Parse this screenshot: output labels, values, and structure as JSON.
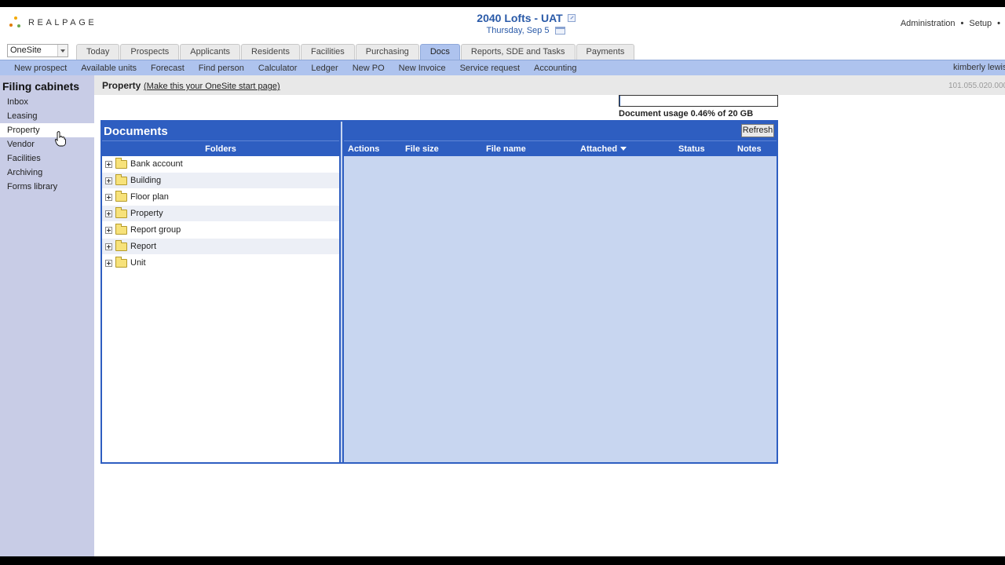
{
  "header": {
    "logo_text": "REALPAGE",
    "property_name": "2040 Lofts - UAT",
    "date": "Thursday, Sep 5",
    "top_links": [
      "Administration",
      "Setup"
    ]
  },
  "product_select": {
    "value": "OneSite"
  },
  "tabs": [
    {
      "label": "Today"
    },
    {
      "label": "Prospects"
    },
    {
      "label": "Applicants"
    },
    {
      "label": "Residents"
    },
    {
      "label": "Facilities"
    },
    {
      "label": "Purchasing"
    },
    {
      "label": "Docs"
    },
    {
      "label": "Reports, SDE and Tasks"
    },
    {
      "label": "Payments"
    }
  ],
  "active_tab": "Docs",
  "subnav": {
    "items": [
      "New prospect",
      "Available units",
      "Forecast",
      "Find person",
      "Calculator",
      "Ledger",
      "New PO",
      "New Invoice",
      "Service request",
      "Accounting"
    ],
    "user": "kimberly lewis"
  },
  "sidebar": {
    "title": "Filing cabinets",
    "items": [
      "Inbox",
      "Leasing",
      "Property",
      "Vendor",
      "Facilities",
      "Archiving",
      "Forms library"
    ],
    "active": "Property"
  },
  "content": {
    "title": "Property",
    "start_page_link": "(Make this your OneSite start page)",
    "version": "101.055.020.000"
  },
  "usage": {
    "text": "Document usage 0.46% of 20 GB",
    "percent": 0.46
  },
  "documents": {
    "title": "Documents",
    "folders_header": "Folders",
    "folders": [
      "Bank account",
      "Building",
      "Floor plan",
      "Property",
      "Report group",
      "Report",
      "Unit"
    ],
    "refresh_label": "Refresh",
    "columns": [
      "Actions",
      "File size",
      "File name",
      "Attached",
      "Status",
      "Notes"
    ]
  },
  "colors": {
    "accent_blue": "#2e5ec1",
    "tab_active": "#aec3ee",
    "sidebar_bg": "#c8cce6"
  }
}
